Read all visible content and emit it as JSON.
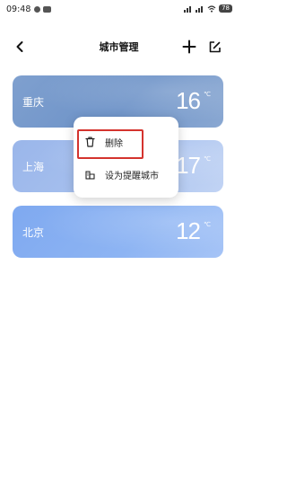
{
  "status_bar": {
    "time": "09:48",
    "battery": "78"
  },
  "nav": {
    "title": "城市管理"
  },
  "cities": [
    {
      "name": "重庆",
      "temp": "16",
      "unit": "℃"
    },
    {
      "name": "上海",
      "temp": "17",
      "unit": "℃"
    },
    {
      "name": "北京",
      "temp": "12",
      "unit": "℃"
    }
  ],
  "context_menu": {
    "delete_label": "删除",
    "set_remind_label": "设为提醒城市"
  },
  "colors": {
    "highlight": "#d4332e",
    "card_chongqing": "#7fa0cf",
    "card_shanghai": "#a9c2ef",
    "card_beijing": "#8db4f3"
  }
}
